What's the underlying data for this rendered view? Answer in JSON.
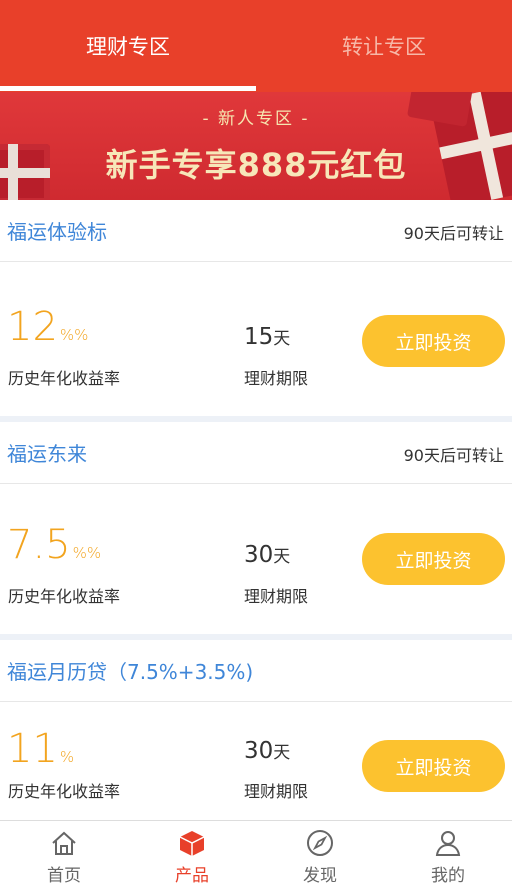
{
  "tabs": [
    {
      "label": "理财专区",
      "active": true
    },
    {
      "label": "转让专区",
      "active": false
    }
  ],
  "banner": {
    "subtitle": "- 新人专区 -",
    "title": "新手专享888元红包"
  },
  "products": [
    {
      "name": "福运体验标",
      "note": "90天后可转让",
      "rate": "12",
      "rate_unit": "%%",
      "rate_label": "历史年化收益率",
      "term": "15",
      "term_unit": "天",
      "term_label": "理财期限",
      "button": "立即投资"
    },
    {
      "name": "福运东来",
      "note": "90天后可转让",
      "rate": "7.5",
      "rate_unit": "%%",
      "rate_label": "历史年化收益率",
      "term": "30",
      "term_unit": "天",
      "term_label": "理财期限",
      "button": "立即投资"
    },
    {
      "name": "福运月历贷（7.5%+3.5%)",
      "note": "",
      "rate": "11",
      "rate_unit": "%",
      "rate_label": "历史年化收益率",
      "term": "30",
      "term_unit": "天",
      "term_label": "理财期限",
      "button": "立即投资"
    }
  ],
  "bottom_nav": [
    {
      "label": "首页",
      "icon": "home-icon",
      "active": false
    },
    {
      "label": "产品",
      "icon": "product-cube-icon",
      "active": true
    },
    {
      "label": "发现",
      "icon": "compass-icon",
      "active": false
    },
    {
      "label": "我的",
      "icon": "user-icon",
      "active": false
    }
  ],
  "colors": {
    "brand_red": "#e8402a",
    "accent_yellow": "#fcc22f",
    "rate_orange": "#f2a41f",
    "link_blue": "#3f86d8"
  }
}
